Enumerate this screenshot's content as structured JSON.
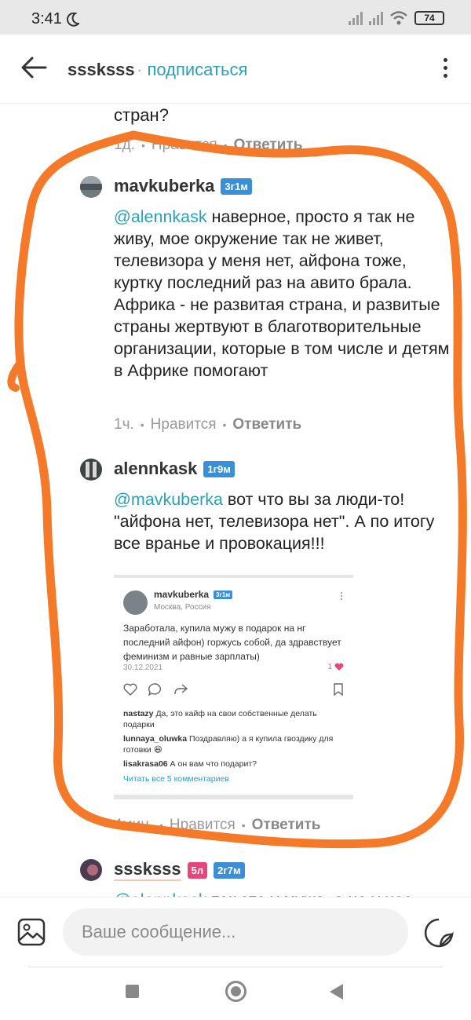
{
  "status_bar": {
    "time": "3:41",
    "battery": "74"
  },
  "header": {
    "username": "sssksss",
    "separator": "·",
    "subscribe": "подписаться"
  },
  "prev_comment": {
    "text_tail": "стран?",
    "age": "1д.",
    "like": "Нравится",
    "reply": "Ответить"
  },
  "comments": [
    {
      "username": "mavkuberka",
      "tag": "3г1м",
      "mention": "@alennkask",
      "text": " наверное, просто я так не живу, мое окружение так не живет, телевизора у меня нет, айфона тоже, куртку последний раз на авито брала. Африка - не развитая страна, и развитые страны жертвуют в благотворительные организации, которые в том числе и детям в Африке помогают",
      "age": "1ч.",
      "like": "Нравится",
      "reply": "Ответить"
    },
    {
      "username": "alennkask",
      "tag": "1г9м",
      "mention": "@mavkuberka",
      "text": " вот что вы за люди-то! \"айфона нет, телевизора нет\". А по итогу все вранье и провокация!!!",
      "age": "4мин.",
      "like": "Нравится",
      "reply": "Ответить"
    },
    {
      "username": "sssksss",
      "tag1": "5л",
      "tag2": "2г7м",
      "mention": "@alennkask",
      "text": " так это у мужа, а не у нее"
    }
  ],
  "embedded_post": {
    "username": "mavkuberka",
    "tag": "3г1м",
    "location": "Москва, Россия",
    "text": "Заработала, купила мужу в подарок на нг последний айфон) горжусь собой, да здравствует феминизм и равные зарплаты)",
    "date": "30.12.2021",
    "likes": "1",
    "comments": [
      {
        "user": "nastazy",
        "text": " Да, это кайф на свои собственные делать подарки"
      },
      {
        "user": "lunnaya_oluwka",
        "text": " Поздравляю) а я купила гвоздику для готовки 😆"
      },
      {
        "user": "lisakrasa06",
        "text": " А он вам что подарит?"
      }
    ],
    "read_all": "Читать все 5 комментариев"
  },
  "composer": {
    "placeholder": "Ваше сообщение..."
  },
  "colors": {
    "accent": "#2aa1b8",
    "tag_blue": "#3a8fd9",
    "tag_pink": "#e8457a",
    "scribble": "#f47a2a"
  }
}
